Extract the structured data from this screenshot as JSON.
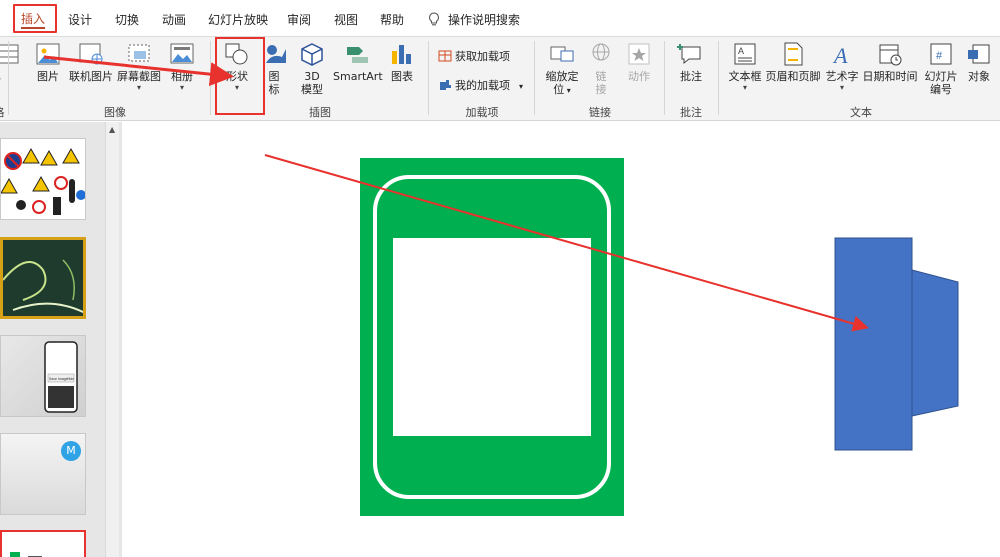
{
  "tabs": [
    "插入",
    "设计",
    "切换",
    "动画",
    "幻灯片放映",
    "审阅",
    "视图",
    "帮助"
  ],
  "tell_me": "操作说明搜索",
  "ribbon": {
    "partial_left_label": "格",
    "partial_left_group": "格",
    "images": {
      "picture": "图片",
      "online_picture": "联机图片",
      "screenshot": "屏幕截图",
      "album": "相册",
      "group": "图像"
    },
    "illustrations": {
      "shapes": "形状",
      "icons_line1": "图",
      "icons_line2": "标",
      "model3d_line1": "3D",
      "model3d_line2": "模型",
      "smartart": "SmartArt",
      "chart": "图表",
      "group": "插图"
    },
    "addins": {
      "get": "获取加载项",
      "mine": "我的加载项",
      "group": "加载项"
    },
    "links": {
      "zoom_line1": "缩放定",
      "zoom_line2": "位",
      "link_line1": "链",
      "link_line2": "接",
      "action": "动作",
      "group": "链接"
    },
    "comments": {
      "comment": "批注",
      "group": "批注"
    },
    "text": {
      "textbox": "文本框",
      "header_footer": "页眉和页脚",
      "wordart": "艺术字",
      "datetime": "日期和时间",
      "slide_number_line1": "幻灯片",
      "slide_number_line2": "编号",
      "object": "对象",
      "group": "文本"
    }
  },
  "slides_panel": {
    "badge": "M",
    "phone_left": "Save Image",
    "phone_right": "Hide"
  },
  "colors": {
    "sign_green": "#00b050",
    "shape_blue": "#4472c4",
    "annotation_red": "#e8322d",
    "accent": "#b7472a"
  }
}
